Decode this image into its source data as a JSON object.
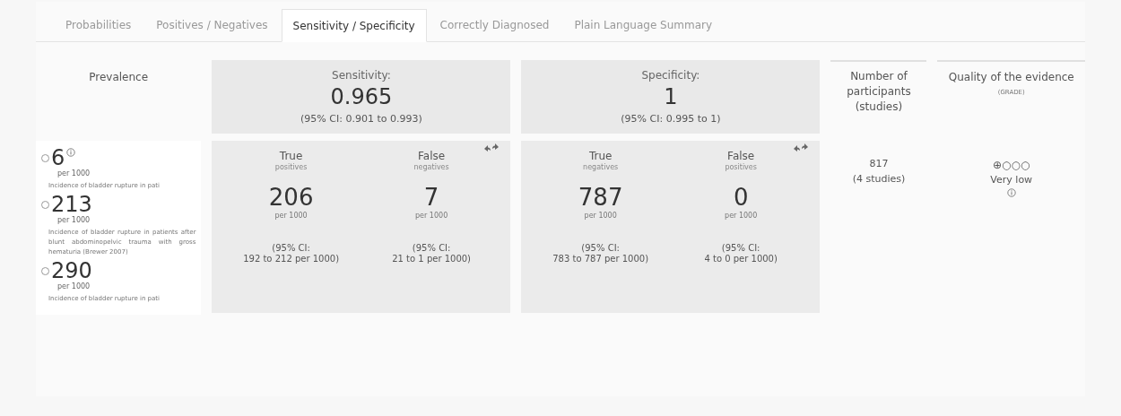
{
  "tabs": [
    {
      "label": "Probabilities",
      "selected": false
    },
    {
      "label": "Positives / Negatives",
      "selected": false
    },
    {
      "label": "Sensitivity / Specificity",
      "selected": true
    },
    {
      "label": "Correctly Diagnosed",
      "selected": false
    },
    {
      "label": "Plain Language Summary",
      "selected": false
    }
  ],
  "prevalence": {
    "header": "Prevalence",
    "options": [
      {
        "value": "6",
        "unit": "per 1000",
        "description": "Incidence of bladder rupture in pati",
        "selected": false,
        "info": true
      },
      {
        "value": "213",
        "unit": "per 1000",
        "description": "Incidence of bladder rupture in patients after blunt abdominopelvic trauma with gross hematuria (Brewer 2007)",
        "selected": false,
        "info": false
      },
      {
        "value": "290",
        "unit": "per 1000",
        "description": "Incidence of bladder rupture in pati",
        "selected": false,
        "info": false
      }
    ]
  },
  "measures": [
    {
      "label": "Sensitivity:",
      "value": "0.965",
      "ci": "(95% CI: 0.901 to 0.993)",
      "cells": [
        {
          "label": "True",
          "sublabel": "positives",
          "value": "206",
          "unit": "per 1000",
          "ci_label": "(95% CI:",
          "ci_range": "192 to 212 per 1000)"
        },
        {
          "label": "False",
          "sublabel": "negatives",
          "value": "7",
          "unit": "per 1000",
          "ci_label": "(95% CI:",
          "ci_range": "21 to 1 per 1000)"
        }
      ]
    },
    {
      "label": "Specificity:",
      "value": "1",
      "ci": "(95% CI: 0.995 to 1)",
      "cells": [
        {
          "label": "True",
          "sublabel": "negatives",
          "value": "787",
          "unit": "per 1000",
          "ci_label": "(95% CI:",
          "ci_range": "783 to 787 per 1000)"
        },
        {
          "label": "False",
          "sublabel": "positives",
          "value": "0",
          "unit": "per 1000",
          "ci_label": "(95% CI:",
          "ci_range": "4 to 0 per 1000)"
        }
      ]
    }
  ],
  "participants": {
    "header": "Number of participants (studies)",
    "count": "817",
    "studies": "(4 studies)"
  },
  "quality": {
    "header": "Quality of the evidence",
    "subheader": "(GRADE)",
    "symbols": "⊕○○○",
    "rating": "Very low"
  }
}
